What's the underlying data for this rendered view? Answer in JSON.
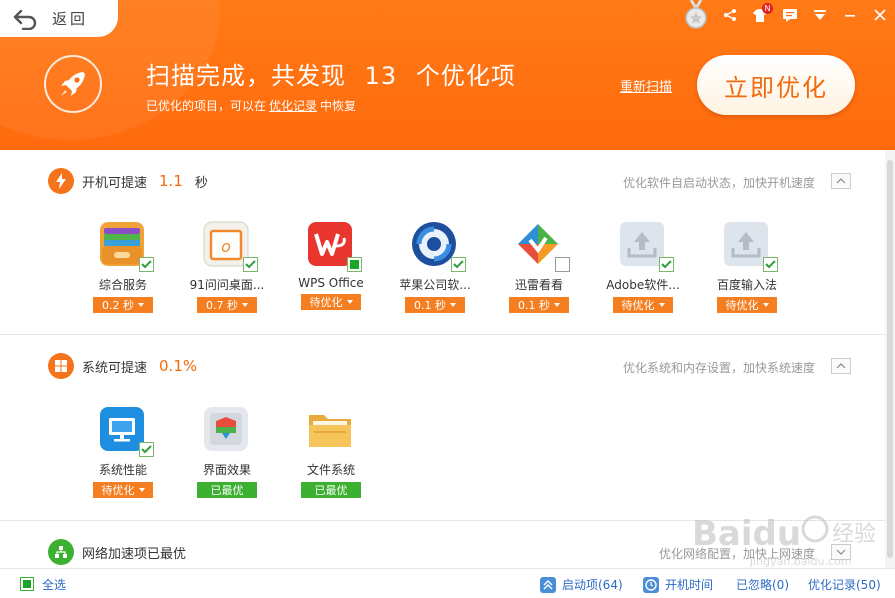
{
  "header": {
    "back_label": "返回",
    "title_prefix": "扫描完成，共发现",
    "title_count": "13",
    "title_suffix": "个优化项",
    "sub_prefix": "已优化的项目，可以在",
    "sub_link": "优化记录",
    "sub_suffix": "中恢复",
    "rescan_label": "重新扫描",
    "optimize_label": "立即优化",
    "badge_letter": "N"
  },
  "sections": [
    {
      "title": "开机可提速",
      "value": "1.1",
      "unit": "秒",
      "desc": "优化软件自启动状态，加快开机速度",
      "items": [
        {
          "name": "综合服务",
          "status": "0.2 秒",
          "icon": "wallet-icon",
          "checked": true
        },
        {
          "name": "91问问桌面...",
          "status": "0.7 秒",
          "icon": "91-icon",
          "checked": true
        },
        {
          "name": "WPS Office",
          "status": "待优化",
          "icon": "wps-icon",
          "checked": true
        },
        {
          "name": "苹果公司软...",
          "status": "0.1 秒",
          "icon": "apple-software-icon",
          "checked": true
        },
        {
          "name": "迅雷看看",
          "status": "0.1 秒",
          "icon": "xunlei-icon",
          "checked": false
        },
        {
          "name": "Adobe软件...",
          "status": "待优化",
          "icon": "upload-placeholder-icon",
          "checked": true
        },
        {
          "name": "百度输入法",
          "status": "待优化",
          "icon": "upload-placeholder-icon",
          "checked": true
        }
      ]
    },
    {
      "title": "系统可提速",
      "value": "0.1%",
      "unit": "",
      "desc": "优化系统和内存设置，加快系统速度",
      "items": [
        {
          "name": "系统性能",
          "status": "待优化",
          "icon": "monitor-icon",
          "checked": true
        },
        {
          "name": "界面效果",
          "status": "已最优",
          "icon": "interface-icon",
          "checked": false
        },
        {
          "name": "文件系统",
          "status": "已最优",
          "icon": "folder-icon",
          "checked": false
        }
      ]
    },
    {
      "title": "网络加速项已最优",
      "desc": "优化网络配置，加快上网速度"
    }
  ],
  "footer": {
    "select_all": "全选",
    "startup": "启动项(64)",
    "boot_time": "开机时间",
    "ignored": "已忽略(0)",
    "records": "优化记录(50)"
  },
  "colors": {
    "brand_orange": "#ff6d0e",
    "accent_orange": "#f57e21",
    "green": "#3cb131",
    "link_blue": "#2b6cc4"
  }
}
